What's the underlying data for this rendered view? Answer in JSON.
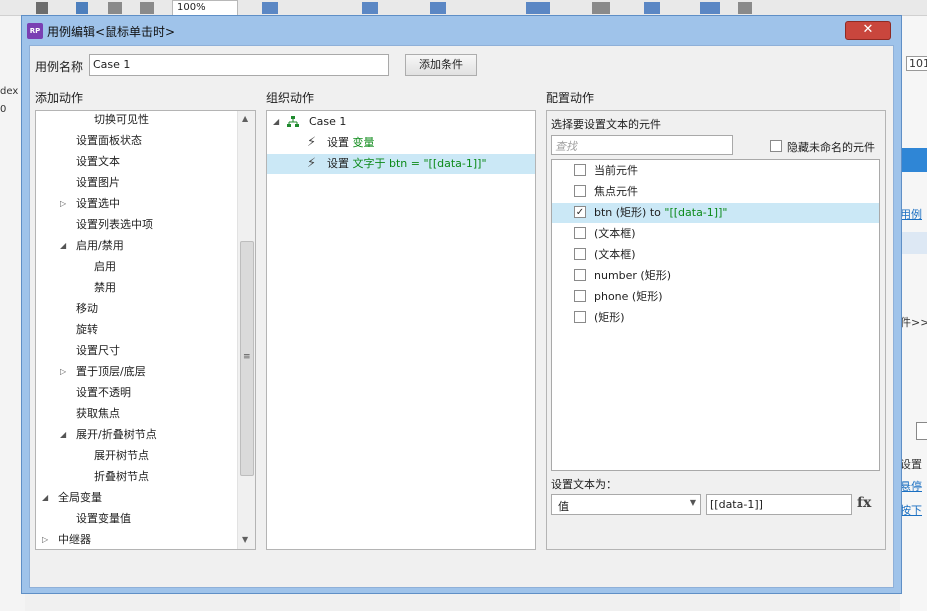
{
  "background": {
    "zoom_value": "100%",
    "left_labels": [
      "dex",
      "0"
    ],
    "right_labels": {
      "top_value": "101",
      "link1": "用例",
      "item2": "件>>",
      "item3": "设置",
      "link4": "悬停",
      "link5": "按下"
    }
  },
  "dialog": {
    "app_icon_text": "RP",
    "title": "用例编辑<鼠标单击时>",
    "close_symbol": "✕",
    "case_name_label": "用例名称",
    "case_name_value": "Case 1",
    "add_condition_label": "添加条件",
    "sections": {
      "add_actions": "添加动作",
      "organize_actions": "组织动作",
      "configure_actions": "配置动作"
    }
  },
  "add_actions_tree": [
    {
      "label": "切换可见性",
      "level": 3
    },
    {
      "label": "设置面板状态",
      "level": 2
    },
    {
      "label": "设置文本",
      "level": 2
    },
    {
      "label": "设置图片",
      "level": 2
    },
    {
      "label": "设置选中",
      "level": 2,
      "arrow": "collapsed"
    },
    {
      "label": "设置列表选中项",
      "level": 2
    },
    {
      "label": "启用/禁用",
      "level": 2,
      "arrow": "expanded"
    },
    {
      "label": "启用",
      "level": 3
    },
    {
      "label": "禁用",
      "level": 3
    },
    {
      "label": "移动",
      "level": 2
    },
    {
      "label": "旋转",
      "level": 2
    },
    {
      "label": "设置尺寸",
      "level": 2
    },
    {
      "label": "置于顶层/底层",
      "level": 2,
      "arrow": "collapsed"
    },
    {
      "label": "设置不透明",
      "level": 2
    },
    {
      "label": "获取焦点",
      "level": 2
    },
    {
      "label": "展开/折叠树节点",
      "level": 2,
      "arrow": "expanded"
    },
    {
      "label": "展开树节点",
      "level": 3
    },
    {
      "label": "折叠树节点",
      "level": 3
    },
    {
      "label": "全局变量",
      "level": 1,
      "arrow": "expanded"
    },
    {
      "label": "设置变量值",
      "level": 2
    },
    {
      "label": "中继器",
      "level": 1,
      "arrow": "collapsed"
    }
  ],
  "organize": {
    "case_label": "Case 1",
    "actions": [
      {
        "prefix": "设置 ",
        "detail": "变量",
        "selected": false
      },
      {
        "prefix": "设置 ",
        "detail": "文字于 btn = \"[[data-1]]\"",
        "selected": true
      }
    ]
  },
  "configure": {
    "choose_label": "选择要设置文本的元件",
    "search_placeholder": "查找",
    "hide_unnamed_label": "隐藏未命名的元件",
    "widgets": [
      {
        "label": "当前元件",
        "checked": false,
        "selected": false
      },
      {
        "label": "焦点元件",
        "checked": false,
        "selected": false
      },
      {
        "label": "btn (矩形) to ",
        "detail": "\"[[data-1]]\"",
        "checked": true,
        "selected": true
      },
      {
        "label": "(文本框)",
        "checked": false,
        "selected": false
      },
      {
        "label": "(文本框)",
        "checked": false,
        "selected": false
      },
      {
        "label": "number (矩形)",
        "checked": false,
        "selected": false
      },
      {
        "label": "phone (矩形)",
        "checked": false,
        "selected": false
      },
      {
        "label": "(矩形)",
        "checked": false,
        "selected": false
      }
    ],
    "set_text_label": "设置文本为：",
    "type_value": "值",
    "text_value": "[[data-1]]",
    "fx_label": "fx"
  }
}
